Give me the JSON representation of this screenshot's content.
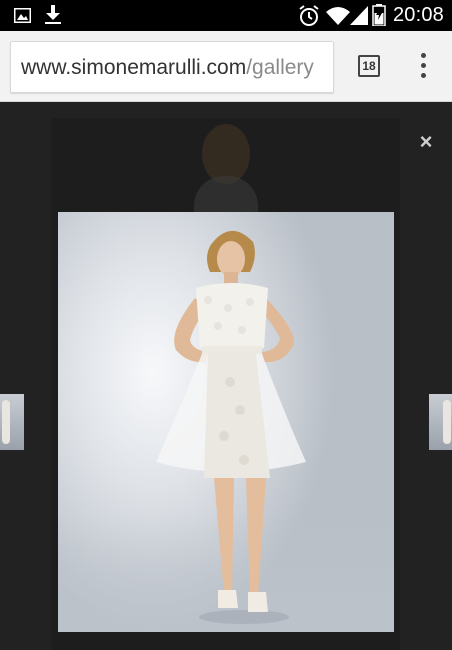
{
  "status_bar": {
    "time": "20:08",
    "icons": [
      "image-notification-icon",
      "download-icon",
      "alarm-icon",
      "wifi-icon",
      "signal-icon",
      "battery-icon"
    ]
  },
  "browser": {
    "url_host": "www.simonemarulli.com",
    "url_path": "/gallery",
    "tab_count": "18",
    "menu_icon": "overflow-menu-icon"
  },
  "gallery": {
    "close_label": "×",
    "close_icon": "close-icon"
  },
  "colors": {
    "status_bar": "#000000",
    "toolbar": "#f2f2f2",
    "overlay": "#222222"
  }
}
